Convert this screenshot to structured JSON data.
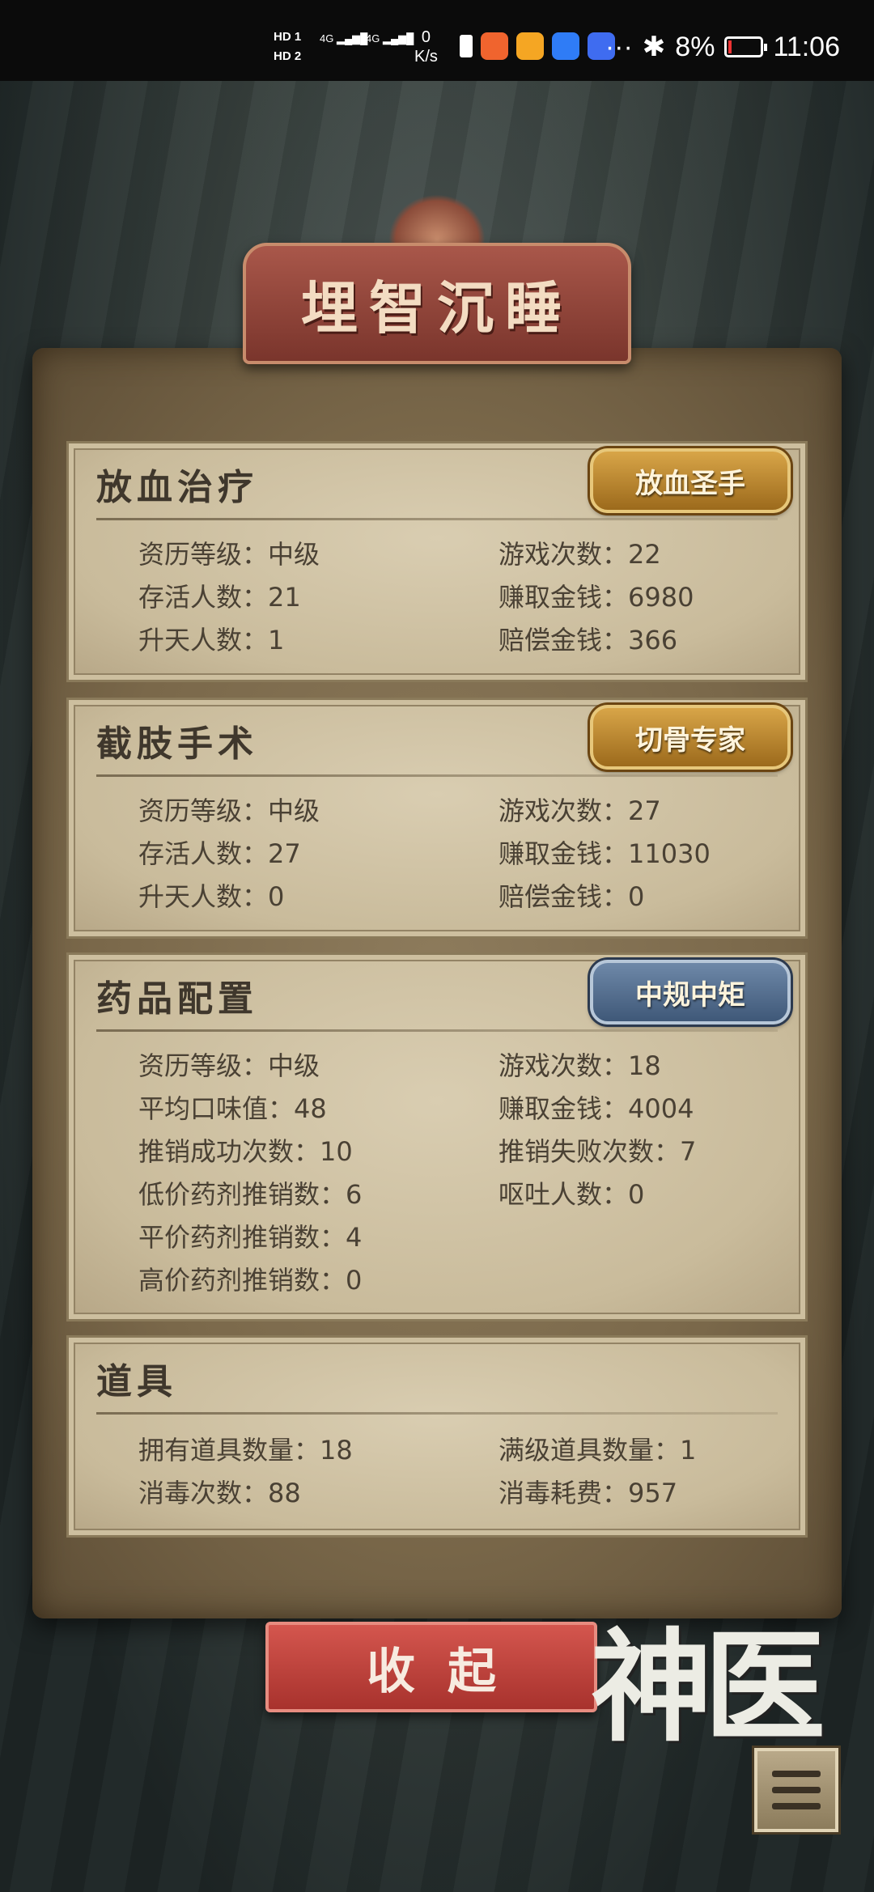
{
  "status_bar": {
    "hd1": "HD 1",
    "hd2": "HD 2",
    "sig1": "4G",
    "sig2": "4G",
    "net_speed": "0",
    "net_unit": "K/s",
    "more": "···",
    "bluetooth": "✱",
    "battery_percent": "8%",
    "time": "11:06"
  },
  "banner": {
    "title": "埋智沉睡"
  },
  "sections": [
    {
      "title": "放血治疗",
      "badge": "放血圣手",
      "badge_style": "gold",
      "rows": [
        [
          "资历等级：中级",
          "游戏次数：22"
        ],
        [
          "存活人数：21",
          "赚取金钱：6980"
        ],
        [
          "升天人数：1",
          "赔偿金钱：366"
        ]
      ]
    },
    {
      "title": "截肢手术",
      "badge": "切骨专家",
      "badge_style": "gold",
      "rows": [
        [
          "资历等级：中级",
          "游戏次数：27"
        ],
        [
          "存活人数：27",
          "赚取金钱：11030"
        ],
        [
          "升天人数：0",
          "赔偿金钱：0"
        ]
      ]
    },
    {
      "title": "药品配置",
      "badge": "中规中矩",
      "badge_style": "blue",
      "rows": [
        [
          "资历等级：中级",
          "游戏次数：18"
        ],
        [
          "平均口味值：48",
          "赚取金钱：4004"
        ],
        [
          "推销成功次数：10",
          "推销失败次数：7"
        ],
        [
          "低价药剂推销数：6",
          "呕吐人数：0"
        ],
        [
          "平价药剂推销数：4",
          ""
        ],
        [
          "高价药剂推销数：0",
          ""
        ]
      ]
    },
    {
      "title": "道具",
      "badge": "",
      "badge_style": "",
      "rows": [
        [
          "拥有道具数量：18",
          "满级道具数量：1"
        ],
        [
          "消毒次数：88",
          "消毒耗费：957"
        ]
      ]
    }
  ],
  "buttons": {
    "collapse": "收起"
  },
  "logo": {
    "text": "神医"
  },
  "icons": {
    "menu": "menu-icon"
  },
  "colors": {
    "accent_red": "#c0423c",
    "badge_gold": "#c08a34",
    "badge_blue": "#566f90"
  }
}
